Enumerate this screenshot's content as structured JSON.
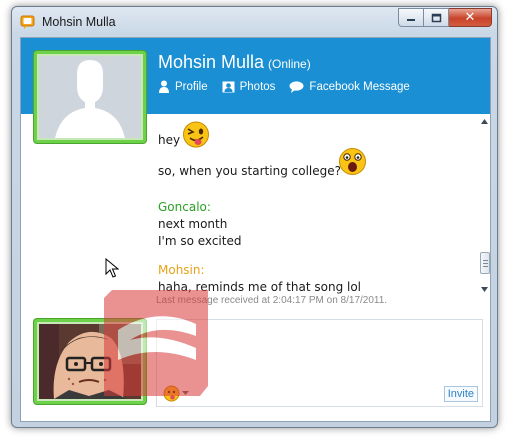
{
  "window": {
    "title": "Mohsin Mulla",
    "close_glyph": "✕"
  },
  "header": {
    "name": "Mohsin Mulla",
    "status": "(Online)",
    "links": [
      {
        "label": "Profile",
        "icon": "person-icon"
      },
      {
        "label": "Photos",
        "icon": "photo-icon"
      },
      {
        "label": "Facebook Message",
        "icon": "speech-bubble-icon"
      }
    ]
  },
  "messages": {
    "m1": "hey",
    "m2": "so, when you starting college?",
    "sender_goncalo": "Goncalo:",
    "m3": "next month",
    "m4": "I'm so excited",
    "sender_mohsin": "Mohsin:",
    "m5": "haha, reminds me of that song lol"
  },
  "status_line": "Last message received at 2:04:17 PM on 8/17/2011.",
  "input": {
    "invite_label": "Invite"
  },
  "colors": {
    "header_blue": "#1a8fd3",
    "avatar_border_green": "#6ed14a",
    "sender_goncalo": "#2aa025",
    "sender_mohsin": "#e8a21a"
  }
}
